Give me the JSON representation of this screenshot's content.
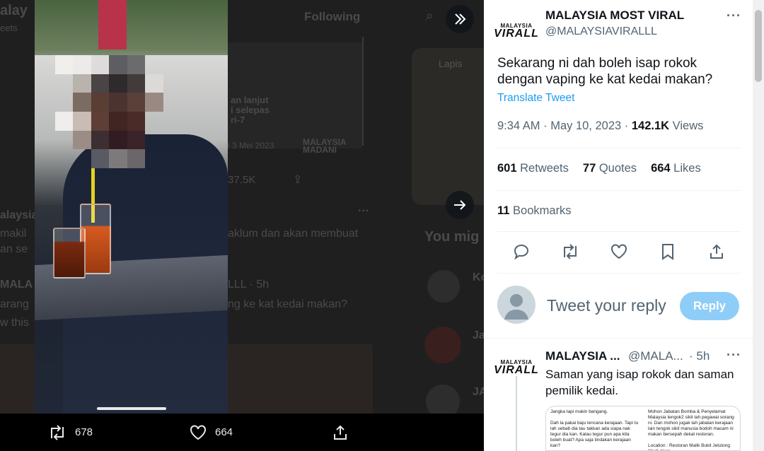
{
  "background_timeline": {
    "header_left": "alay",
    "header_left_sub": "eets",
    "tab_following": "Following",
    "date_stamp": "i 3 Mei 2023",
    "view_count": "37.5K",
    "post_line1": "alaysia",
    "post_line2": "makil",
    "post_line2b": "aklum dan akan membuat",
    "post_line3": "an se",
    "post2_name": "MALA",
    "post2_handle": "LLL · 5h",
    "post2_text": "arang",
    "post2_text_b": "ng ke kat kedai makan?",
    "post2_link": "w this",
    "you_might_like": "You mig",
    "sugg1": "Ko",
    "sugg2": "Ja",
    "sugg3": "JA",
    "poster_text1": "an lanjut",
    "poster_text2": "i selepas",
    "poster_text3": "ri-7",
    "madani": "MALAYSIA MADANI",
    "book_title": "Lapis"
  },
  "media_viewer": {
    "retweet_count": "678",
    "like_count": "664",
    "icons": {
      "expand": "double-chevron-right-icon",
      "next": "arrow-right-icon",
      "retweet": "retweet-icon",
      "like": "heart-icon",
      "share": "share-icon"
    }
  },
  "tweet": {
    "logo_line1": "MALAYSIA",
    "logo_line2": "VIRALL",
    "author_name": "MALAYSIA MOST VIRAL",
    "author_handle": "@MALAYSIAVIRALLL",
    "text": "Sekarang ni dah boleh isap rokok dengan vaping ke kat kedai makan?",
    "translate_label": "Translate Tweet",
    "time_date": "9:34 AM · May 10, 2023 · ",
    "views_count": "142.1K",
    "views_label": " Views",
    "retweets_count": "601",
    "retweets_label": " Retweets",
    "quotes_count": "77",
    "quotes_label": " Quotes",
    "likes_count": "664",
    "likes_label": " Likes",
    "bookmarks_count": "11",
    "bookmarks_label": " Bookmarks"
  },
  "reply_box": {
    "placeholder": "Tweet your reply",
    "button_label": "Reply"
  },
  "reply_tweet": {
    "author_name": "MALAYSIA ...",
    "author_handle": "@MALA...",
    "time": "· 5h",
    "text": "Saman yang isap rokok dan saman pemilik kedai.",
    "image_col1": "Jangka tapi makin bangang.\n\nDah la pakai baju lencana kerajaan. Tapi tu lah sebab dia tau takkan ada siapa nak tegur dia kan. Kalau tegur pun apa kita boleh buat? Apa saja tindakan kerajaan kan?\n\nPeraturan dah ada, pelaksanaan tu lemah.",
    "image_col2": "Mohon Jabatan Bomba & Penyelamat Malaysia tengok2 sikit lah pegawai sorang ni. Dan mohon jugak lah jabatan kerajaan lain tengok sikit manusia bodoh macam ni makan bersepah dekat restoran.\n\nLocation : Restoran Malik Bukit Jelutong Shah Alam"
  },
  "colors": {
    "accent": "#1d9bf0",
    "reply_button_disabled": "#8ecdf7",
    "text_primary": "#0f1419",
    "text_secondary": "#536471"
  }
}
